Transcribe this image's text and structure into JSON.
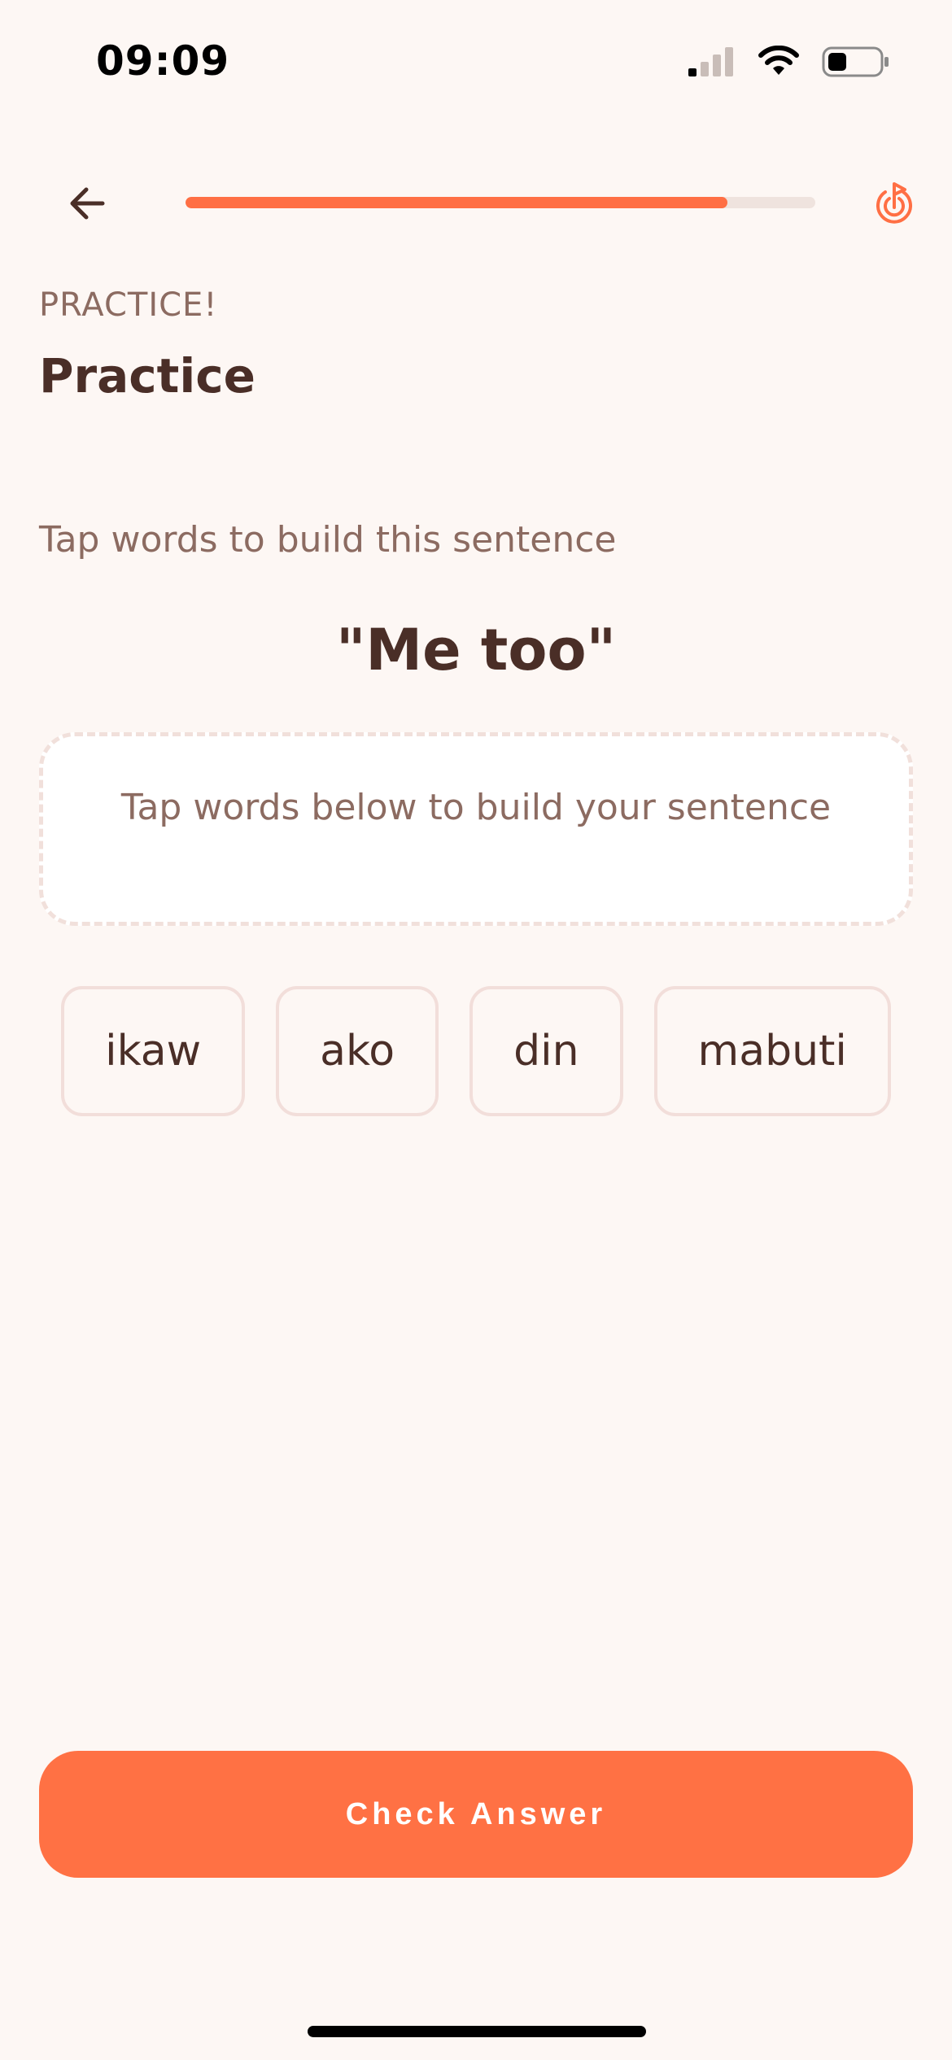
{
  "status_bar": {
    "time": "09:09",
    "icons": [
      "cellular-signal-icon",
      "wifi-icon",
      "battery-icon"
    ]
  },
  "header": {
    "back_icon": "arrow-left-icon",
    "progress": 0.86,
    "hint_icon": "target-icon",
    "accent_color": "#FF6F44"
  },
  "lesson": {
    "eyebrow": "PRACTICE!",
    "title": "Practice"
  },
  "exercise": {
    "instruction": "Tap words to build this sentence",
    "target_sentence": "\"Me too\"",
    "answer_placeholder": "Tap words below to build your sentence",
    "word_bank": [
      "ikaw",
      "ako",
      "din",
      "mabuti"
    ]
  },
  "footer": {
    "check_label": "Check Answer",
    "button_color": "#FF7144"
  }
}
